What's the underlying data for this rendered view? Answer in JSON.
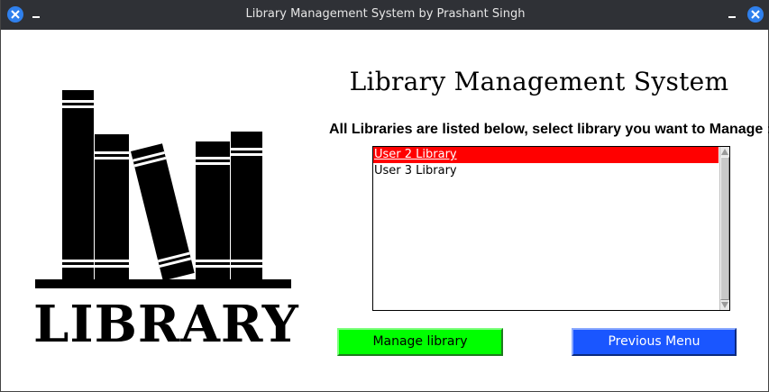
{
  "window": {
    "title": "Library Management System by Prashant Singh"
  },
  "logo": {
    "text": "LIBRARY"
  },
  "main": {
    "heading": "Library Management System",
    "instruction": "All Libraries are listed below, select library you want to Manage :-"
  },
  "library_list": {
    "items": [
      {
        "label": "User 2 Library",
        "selected": true
      },
      {
        "label": "User 3 Library",
        "selected": false
      }
    ]
  },
  "buttons": {
    "manage_label": "Manage library",
    "previous_label": "Previous Menu"
  },
  "colors": {
    "selected_row": "#ff0000",
    "manage_button": "#00ff00",
    "previous_button": "#1a56ff",
    "titlebar": "#2f3136"
  }
}
